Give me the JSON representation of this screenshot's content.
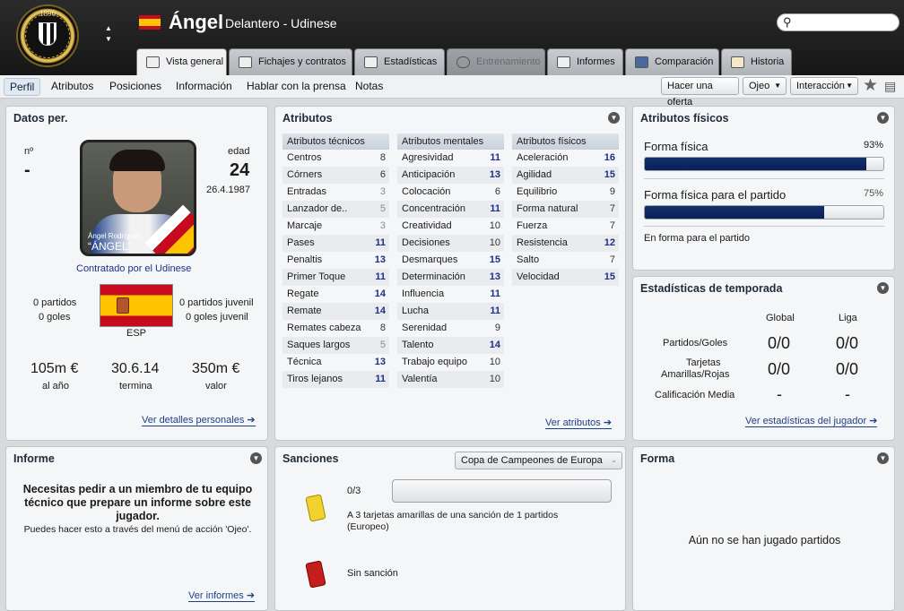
{
  "header": {
    "club_year": "1896",
    "player_name": "Ángel",
    "player_subtitle": "Delantero - Udinese"
  },
  "tabs": [
    {
      "label": "Vista general"
    },
    {
      "label": "Fichajes y contratos"
    },
    {
      "label": "Estadísticas"
    },
    {
      "label": "Entrenamiento"
    },
    {
      "label": "Informes"
    },
    {
      "label": "Comparación"
    },
    {
      "label": "Historia"
    }
  ],
  "subnav": {
    "items": [
      "Perfil",
      "Atributos",
      "Posiciones",
      "Información",
      "Hablar con la prensa",
      "Notas"
    ],
    "offer": "Hacer una oferta",
    "scout": "Ojeo",
    "interaction": "Interacción"
  },
  "personal": {
    "title": "Datos per.",
    "num_label": "nº",
    "num_value": "-",
    "age_label": "edad",
    "age_value": "24",
    "dob": "26.4.1987",
    "photo_caption_small": "Ángel  Rodríguez",
    "photo_caption_big": "“ÁNGEL”",
    "contract": "Contratado por el Udinese",
    "matches": "0 partidos",
    "goals": "0 goles",
    "youth_matches": "0 partidos juvenil",
    "youth_goals": "0 goles juvenil",
    "nation": "ESP",
    "wage": "105m €",
    "wage_label": "al año",
    "expiry": "30.6.14",
    "expiry_label": "termina",
    "value": "350m €",
    "value_label": "valor",
    "link": "Ver detalles personales"
  },
  "attributes": {
    "title": "Atributos",
    "technical_header": "Atributos técnicos",
    "mental_header": "Atributos mentales",
    "physical_header": "Atributos físicos",
    "technical": [
      {
        "n": "Centros",
        "v": "8"
      },
      {
        "n": "Córners",
        "v": "6"
      },
      {
        "n": "Entradas",
        "v": "3"
      },
      {
        "n": "Lanzador de..",
        "v": "5"
      },
      {
        "n": "Marcaje",
        "v": "3"
      },
      {
        "n": "Pases",
        "v": "11"
      },
      {
        "n": "Penaltis",
        "v": "13"
      },
      {
        "n": "Primer Toque",
        "v": "11"
      },
      {
        "n": "Regate",
        "v": "14"
      },
      {
        "n": "Remate",
        "v": "14"
      },
      {
        "n": "Remates cabeza",
        "v": "8"
      },
      {
        "n": "Saques largos",
        "v": "5"
      },
      {
        "n": "Técnica",
        "v": "13"
      },
      {
        "n": "Tiros lejanos",
        "v": "11"
      }
    ],
    "mental": [
      {
        "n": "Agresividad",
        "v": "11"
      },
      {
        "n": "Anticipación",
        "v": "13"
      },
      {
        "n": "Colocación",
        "v": "6"
      },
      {
        "n": "Concentración",
        "v": "11"
      },
      {
        "n": "Creatividad",
        "v": "10"
      },
      {
        "n": "Decisiones",
        "v": "10"
      },
      {
        "n": "Desmarques",
        "v": "15"
      },
      {
        "n": "Determinación",
        "v": "13"
      },
      {
        "n": "Influencia",
        "v": "11"
      },
      {
        "n": "Lucha",
        "v": "11"
      },
      {
        "n": "Serenidad",
        "v": "9"
      },
      {
        "n": "Talento",
        "v": "14"
      },
      {
        "n": "Trabajo equipo",
        "v": "10"
      },
      {
        "n": "Valentía",
        "v": "10"
      }
    ],
    "physical": [
      {
        "n": "Aceleración",
        "v": "16"
      },
      {
        "n": "Agilidad",
        "v": "15"
      },
      {
        "n": "Equilibrio",
        "v": "9"
      },
      {
        "n": "Forma natural",
        "v": "7"
      },
      {
        "n": "Fuerza",
        "v": "7"
      },
      {
        "n": "Resistencia",
        "v": "12"
      },
      {
        "n": "Salto",
        "v": "7"
      },
      {
        "n": "Velocidad",
        "v": "15"
      }
    ],
    "link": "Ver atributos"
  },
  "fitness": {
    "title": "Atributos físicos",
    "fitness_label": "Forma física",
    "fitness_pct": "93%",
    "fitness_value": 93,
    "match_label": "Forma física para el partido",
    "match_pct": "75%",
    "match_value": 75,
    "status": "En forma para el partido"
  },
  "season": {
    "title": "Estadísticas de temporada",
    "col_global": "Global",
    "col_league": "Liga",
    "row1": "Partidos/Goles",
    "row1_g": "0/0",
    "row1_l": "0/0",
    "row2a": "Tarjetas",
    "row2b": "Amarillas/Rojas",
    "row2_g": "0/0",
    "row2_l": "0/0",
    "row3": "Calificación Media",
    "row3_g": "-",
    "row3_l": "-",
    "link": "Ver estadísticas del jugador"
  },
  "report": {
    "title": "Informe",
    "line1": "Necesitas pedir a un miembro de tu equipo",
    "line2": "técnico que prepare un informe sobre este",
    "line3": "jugador.",
    "hint": "Puedes hacer esto a través del menú de acción 'Ojeo'.",
    "link": "Ver informes"
  },
  "sanctions": {
    "title": "Sanciones",
    "competition": "Copa de Campeones de Europa",
    "yellow_count": "0/3",
    "yellow_progress": 0,
    "yellow_text1": "A 3 tarjetas amarillas de una sanción de 1 partidos",
    "yellow_text2": "(Europeo)",
    "red_text": "Sin sanción",
    "yellow_color": "#f2d22e",
    "red_color": "#c41e1e"
  },
  "form": {
    "title": "Forma",
    "empty": "Aún no se han jugado partidos"
  }
}
